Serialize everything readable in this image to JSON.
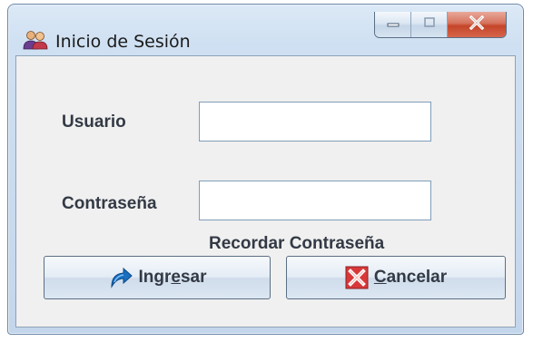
{
  "window": {
    "title": "Inicio de Sesión",
    "icon": "users-icon",
    "controls": {
      "minimize": "minimize-icon",
      "maximize": "maximize-icon",
      "close": "close-icon",
      "close_color": "#c4452a"
    }
  },
  "form": {
    "user_label": "Usuario",
    "user_value": "",
    "password_label": "Contraseña",
    "password_value": "",
    "remember_text": "Recordar Contraseña"
  },
  "buttons": {
    "login": {
      "prefix": "Ingr",
      "mnemonic": "e",
      "suffix": "sar",
      "icon": "refresh-arrow-icon",
      "icon_color": "#1a6fc0"
    },
    "cancel": {
      "prefix": "",
      "mnemonic": "C",
      "suffix": "ancelar",
      "icon": "cancel-x-icon",
      "icon_color": "#d8383a"
    }
  }
}
